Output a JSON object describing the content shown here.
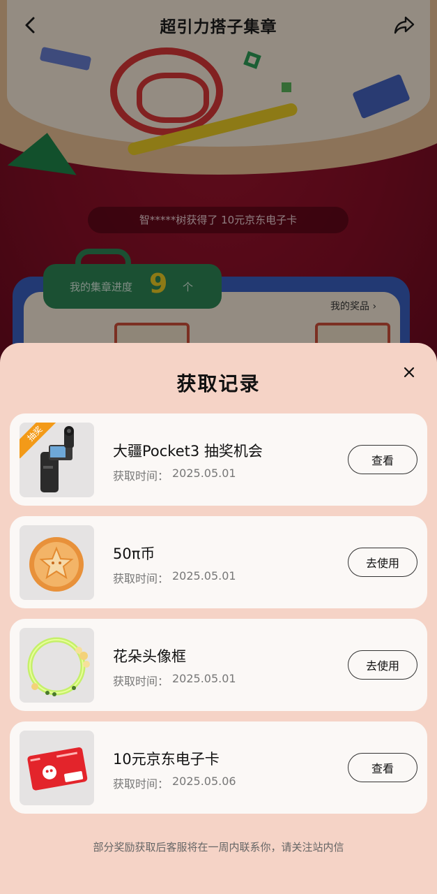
{
  "nav": {
    "title": "超引力搭子集章"
  },
  "background": {
    "ticker": "智*****树获得了 10元京东电子卡",
    "progress_label": "我的集章进度",
    "progress_count": "9",
    "progress_unit": "个",
    "prize_link": "我的奖品"
  },
  "sheet": {
    "title": "获取记录",
    "records": [
      {
        "thumb": "dji-pocket3-camera",
        "badge": "抽奖",
        "name": "大疆Pocket3 抽奖机会",
        "time_label": "获取时间：",
        "time": "2025.05.01",
        "button": "查看"
      },
      {
        "thumb": "pi-coin",
        "name": "50π币",
        "time_label": "获取时间：",
        "time": "2025.05.01",
        "button": "去使用"
      },
      {
        "thumb": "flower-avatar-frame",
        "name": "花朵头像框",
        "time_label": "获取时间：",
        "time": "2025.05.01",
        "button": "去使用"
      },
      {
        "thumb": "jd-gift-card",
        "name": "10元京东电子卡",
        "time_label": "获取时间：",
        "time": "2025.05.06",
        "button": "查看"
      }
    ],
    "footer_note": "部分奖励获取后客服将在一周内联系你，请关注站内信"
  },
  "colors": {
    "sheet_bg": "#f5d3c6",
    "card_bg": "#fbf8f6",
    "badge_orange": "#f39a18",
    "page_red": "#8d0f28"
  }
}
